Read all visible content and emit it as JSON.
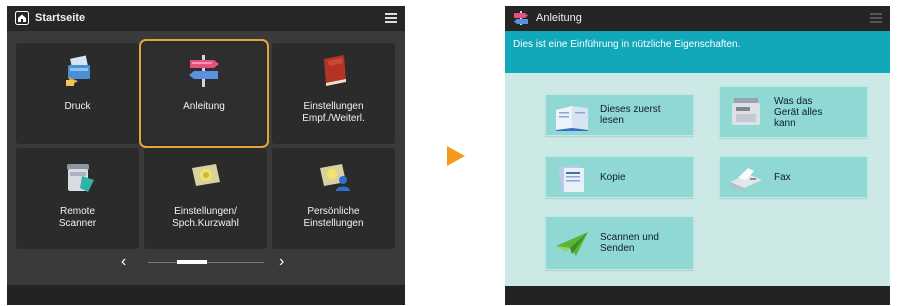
{
  "left_screen": {
    "title": "Startseite",
    "tiles": [
      {
        "label": "Druck",
        "icon": "print-icon"
      },
      {
        "label": "Anleitung",
        "icon": "signpost-icon",
        "selected": true
      },
      {
        "label": "Einstellungen\nEmpf./Weiterl.",
        "icon": "red-book-icon"
      },
      {
        "label": "Remote\nScanner",
        "icon": "scanner-icon"
      },
      {
        "label": "Einstellungen/\nSpch.Kurzwahl",
        "icon": "settings-card-icon"
      },
      {
        "label": "Persönliche\nEinstellungen",
        "icon": "personal-settings-icon"
      }
    ],
    "pager": {
      "prev": "‹",
      "next": "›"
    }
  },
  "right_screen": {
    "title": "Anleitung",
    "banner": "Dies ist eine Einführung in nützliche Eigenschaften.",
    "tiles": [
      {
        "label": "Dieses zuerst\nlesen",
        "icon": "open-book-icon"
      },
      {
        "label": "Was das\nGerät alles\nkann",
        "icon": "multifunction-device-icon"
      },
      {
        "label": "Kopie",
        "icon": "copy-icon"
      },
      {
        "label": "Fax",
        "icon": "fax-icon"
      },
      {
        "label": "Scannen und\nSenden",
        "icon": "paper-plane-icon"
      }
    ]
  },
  "colors": {
    "selection_border": "#e3a43a",
    "banner": "#11a8b9",
    "tile_teal": "#8fd8d3",
    "arrow": "#f39a1d"
  }
}
